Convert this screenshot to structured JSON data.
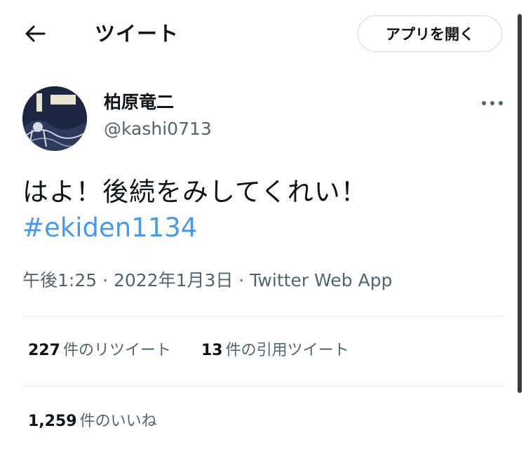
{
  "header": {
    "back_icon": "arrow-left-icon",
    "title": "ツイート",
    "open_app_label": "アプリを開く"
  },
  "tweet": {
    "display_name": "柏原竜二",
    "username": "@kashi0713",
    "avatar_icon": "profile-avatar",
    "more_icon": "more-horizontal-icon",
    "text": "はよ！後続をみしてくれい！",
    "hashtag": "#ekiden1134",
    "time": "午後1:25",
    "separator": "·",
    "date": "2022年1月3日",
    "source": "Twitter Web App"
  },
  "stats": {
    "retweets_count": "227",
    "retweets_label": "件のリツイート",
    "quotes_count": "13",
    "quotes_label": "件の引用ツイート",
    "likes_count": "1,259",
    "likes_label": "件のいいね"
  },
  "colors": {
    "hashtag": "#4a99e9",
    "secondary_text": "#536471",
    "primary_text": "#0f1419",
    "border": "#cfd9de"
  }
}
